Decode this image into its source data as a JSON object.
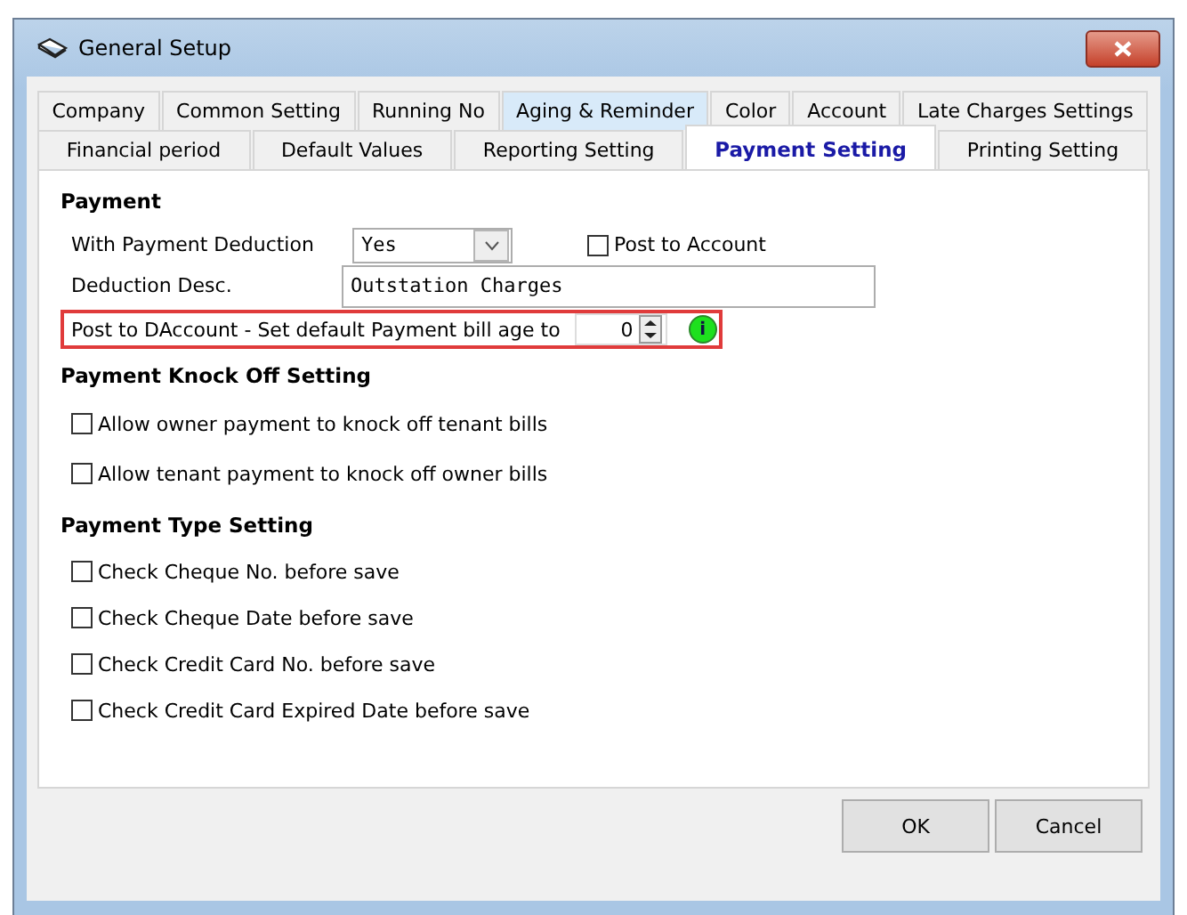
{
  "window": {
    "title": "General Setup"
  },
  "tab_rows": [
    [
      {
        "label": "Company",
        "selected": false,
        "highlighted": false
      },
      {
        "label": "Common Setting",
        "selected": false,
        "highlighted": false
      },
      {
        "label": "Running No",
        "selected": false,
        "highlighted": false
      },
      {
        "label": "Aging & Reminder",
        "selected": false,
        "highlighted": true
      },
      {
        "label": "Color",
        "selected": false,
        "highlighted": false
      },
      {
        "label": "Account",
        "selected": false,
        "highlighted": false
      },
      {
        "label": "Late Charges Settings",
        "selected": false,
        "highlighted": false
      }
    ],
    [
      {
        "label": "Financial period",
        "selected": false,
        "highlighted": false
      },
      {
        "label": "Default Values",
        "selected": false,
        "highlighted": false
      },
      {
        "label": "Reporting Setting",
        "selected": false,
        "highlighted": false
      },
      {
        "label": "Payment Setting",
        "selected": true,
        "highlighted": false
      },
      {
        "label": "Printing Setting",
        "selected": false,
        "highlighted": false
      }
    ]
  ],
  "payment": {
    "heading": "Payment",
    "deduction_label": "With Payment Deduction",
    "deduction_value": "Yes",
    "post_to_account": {
      "label": "Post to Account",
      "checked": false
    },
    "desc_label": "Deduction Desc.",
    "desc_value": "Outstation Charges",
    "bill_age_label": "Post to DAccount - Set default Payment bill age to",
    "bill_age_value": "0",
    "info_icon": "i"
  },
  "knock_off": {
    "heading": "Payment Knock Off Setting",
    "options": [
      {
        "label": "Allow owner payment to knock off tenant bills",
        "checked": false
      },
      {
        "label": "Allow tenant payment to knock off owner bills",
        "checked": false
      }
    ]
  },
  "payment_type": {
    "heading": "Payment Type Setting",
    "options": [
      {
        "label": "Check Cheque No. before save",
        "checked": false
      },
      {
        "label": "Check Cheque Date before save",
        "checked": false
      },
      {
        "label": "Check Credit Card No. before save",
        "checked": false
      },
      {
        "label": "Check Credit Card Expired Date before save",
        "checked": false
      }
    ]
  },
  "buttons": [
    "OK",
    "Cancel"
  ]
}
